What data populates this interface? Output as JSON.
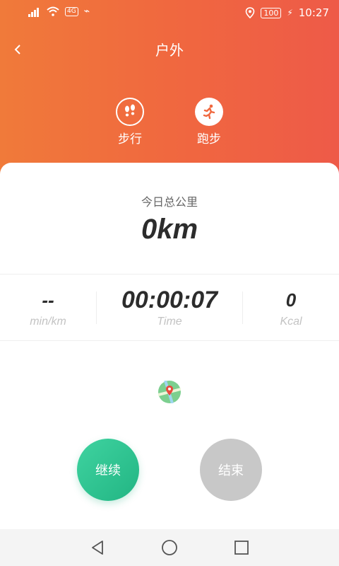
{
  "status_bar": {
    "data_badge": "4G",
    "time": "10:27",
    "battery": "100"
  },
  "nav": {
    "title": "户外"
  },
  "modes": [
    {
      "label": "步行",
      "icon": "footprints-icon",
      "selected": false
    },
    {
      "label": "跑步",
      "icon": "running-icon",
      "selected": true
    }
  ],
  "summary": {
    "total_label": "今日总公里",
    "total_value": "0km"
  },
  "metrics": {
    "pace": {
      "value": "--",
      "unit": "min/km"
    },
    "time": {
      "value": "00:00:07",
      "unit": "Time"
    },
    "calories": {
      "value": "0",
      "unit": "Kcal"
    }
  },
  "actions": {
    "continue_label": "继续",
    "end_label": "结束"
  },
  "colors": {
    "header_start": "#f07a3a",
    "header_end": "#ee5a48",
    "continue_green": "#2ec490",
    "end_gray": "#c8c8c8"
  }
}
